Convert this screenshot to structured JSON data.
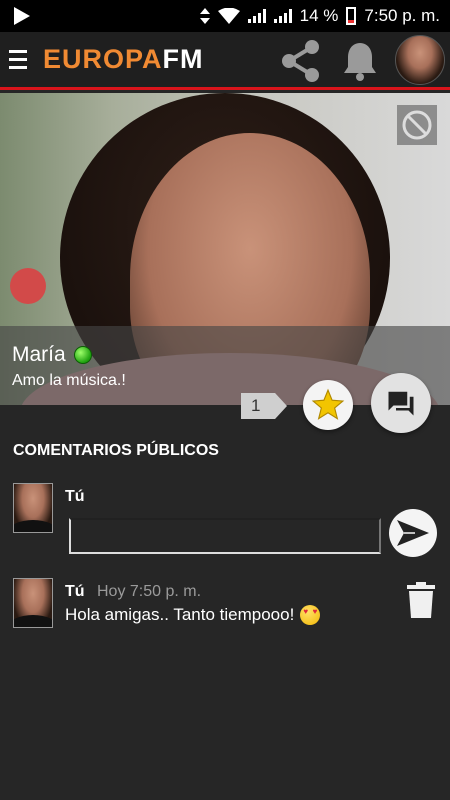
{
  "status_bar": {
    "battery": "14 %",
    "time": "7:50 p. m."
  },
  "app": {
    "logo_part1": "EUROPA",
    "logo_part2": "FM"
  },
  "icons": {
    "menu": "hamburger-icon",
    "share": "share-icon",
    "notifications": "bell-icon",
    "block": "block-icon",
    "star": "star-icon",
    "chat": "chat-icon",
    "send": "send-icon",
    "delete": "trash-icon"
  },
  "colors": {
    "accent": "#d9141b",
    "logo_orange": "#f08a33",
    "online": "#1ea10f",
    "star": "#f2c500"
  },
  "profile": {
    "name": "María",
    "status": "Amo la música.!",
    "online": true,
    "favorites_count": "1"
  },
  "comments": {
    "section_title": "COMENTARIOS PÚBLICOS",
    "composer_author": "Tú",
    "composer_value": "",
    "items": [
      {
        "author": "Tú",
        "time": "Hoy 7:50 p. m.",
        "text": "Hola amigas.. Tanto tiempooo!"
      }
    ]
  }
}
